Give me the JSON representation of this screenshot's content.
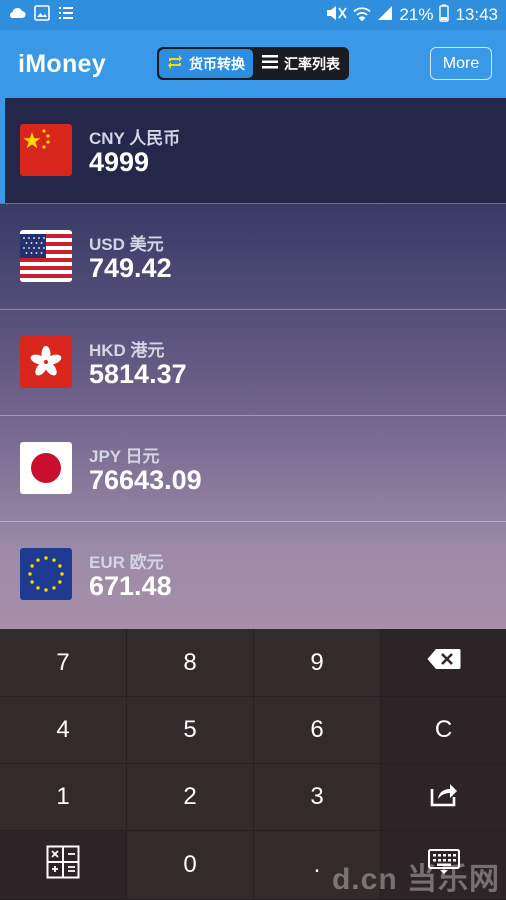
{
  "status_bar": {
    "battery": "21%",
    "time": "13:43",
    "icons": [
      "cloud-icon",
      "image-icon",
      "list-icon",
      "mute-icon",
      "wifi-icon",
      "signal-icon",
      "battery-icon"
    ]
  },
  "app": {
    "title": "iMoney",
    "tabs": [
      {
        "label": "货币转换",
        "icon": "swap-icon",
        "active": true
      },
      {
        "label": "汇率列表",
        "icon": "list-icon",
        "active": false
      }
    ],
    "more_label": "More"
  },
  "currencies": [
    {
      "code": "CNY 人民币",
      "amount": "4999",
      "flag": "china-flag-icon",
      "selected": true
    },
    {
      "code": "USD 美元",
      "amount": "749.42",
      "flag": "usa-flag-icon",
      "selected": false
    },
    {
      "code": "HKD 港元",
      "amount": "5814.37",
      "flag": "hong-kong-flag-icon",
      "selected": false
    },
    {
      "code": "JPY 日元",
      "amount": "76643.09",
      "flag": "japan-flag-icon",
      "selected": false
    },
    {
      "code": "EUR 欧元",
      "amount": "671.48",
      "flag": "eu-flag-icon",
      "selected": false
    }
  ],
  "keypad": {
    "keys": [
      "7",
      "8",
      "9",
      "",
      "4",
      "5",
      "6",
      "C",
      "1",
      "2",
      "3",
      "",
      "",
      "0",
      ".",
      ""
    ],
    "icons": {
      "backspace": "backspace-icon",
      "share": "share-icon",
      "calculator": "calculator-icon",
      "keyboard": "keyboard-icon"
    }
  },
  "watermark": "d.cn 当乐网",
  "colors": {
    "accent": "#3a99e6",
    "selected_row": "#24264a",
    "keypad": "#332a2c"
  }
}
